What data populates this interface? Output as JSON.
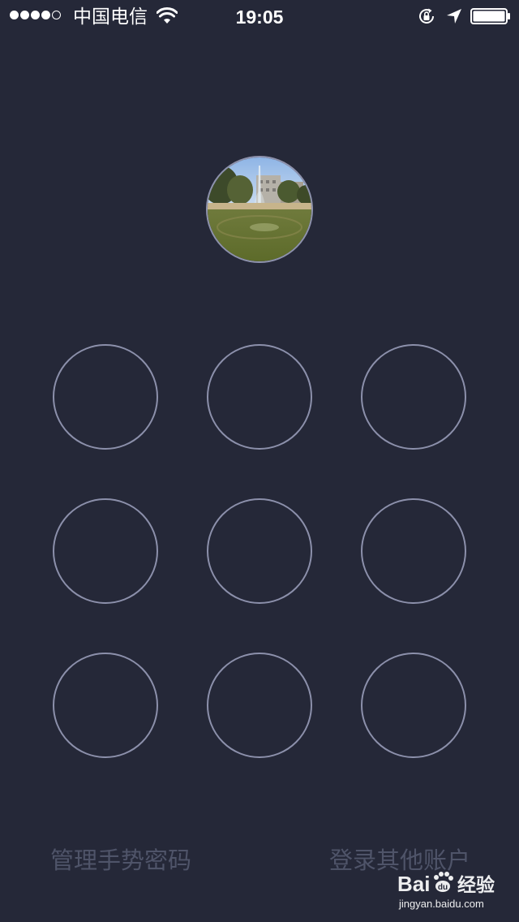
{
  "status_bar": {
    "signal_filled": 4,
    "signal_total": 5,
    "carrier": "中国电信",
    "time": "19:05",
    "icons": [
      "wifi-icon",
      "rotation-lock-icon",
      "location-icon",
      "battery-icon"
    ],
    "battery_level": 1.0
  },
  "avatar": {
    "icon": "profile-photo-fountain"
  },
  "gesture": {
    "rows": 3,
    "columns": 3,
    "ring_color": "#8c90ab"
  },
  "footer": {
    "manage_label": "管理手势密码",
    "other_account_label": "登录其他账户"
  },
  "watermark": {
    "logo_text": "Bai百经验",
    "url": "jingyan.baidu.com"
  },
  "colors": {
    "background": "#252838",
    "link_text": "#4f5469"
  }
}
